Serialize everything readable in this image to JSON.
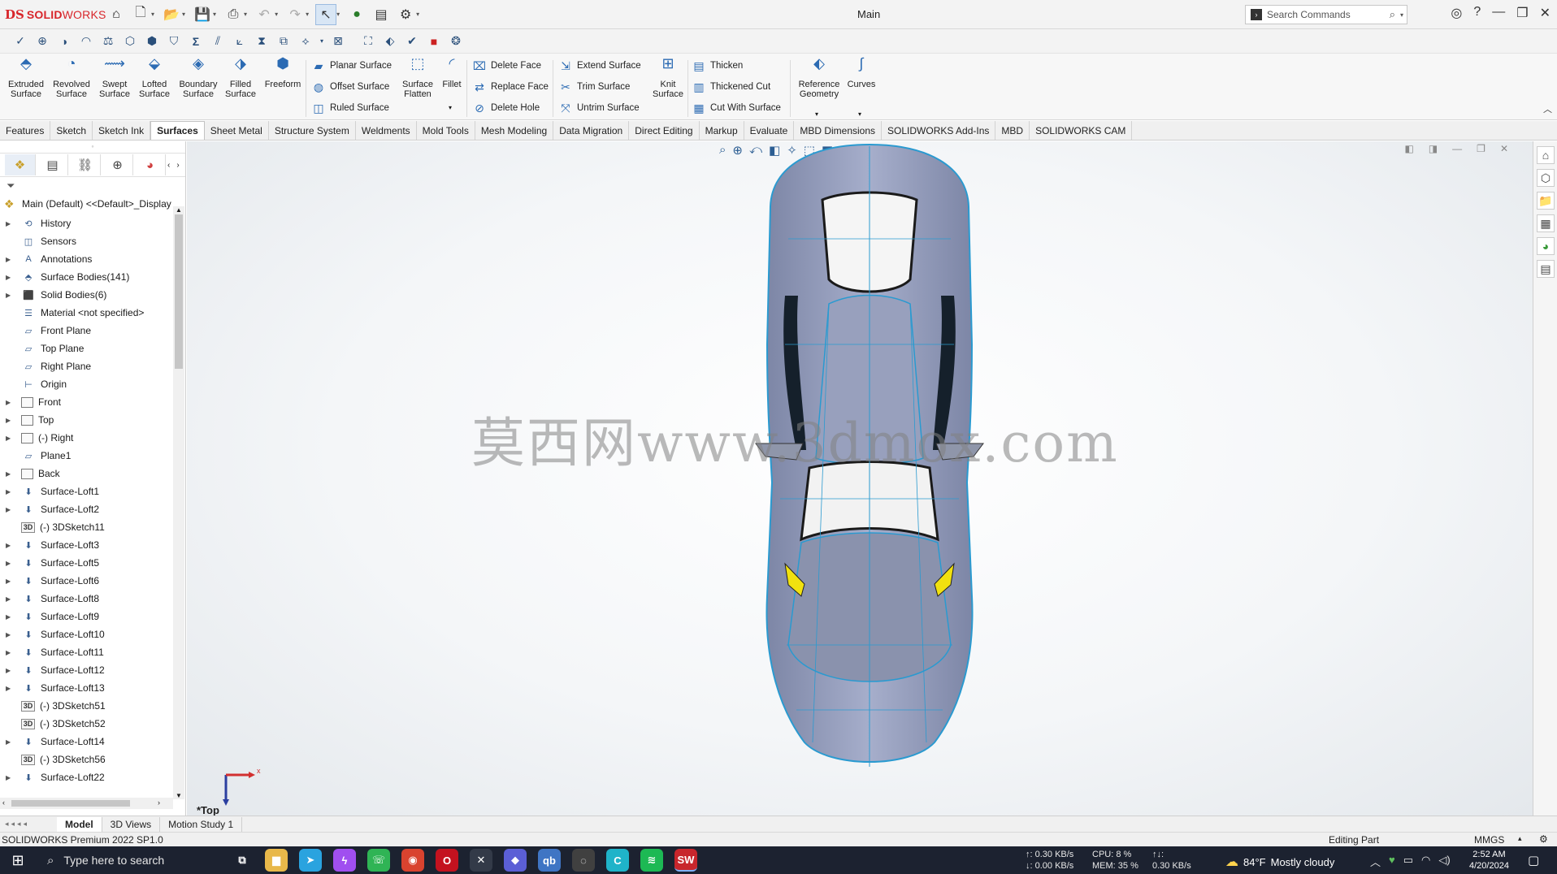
{
  "app": {
    "logo_ds": "DS",
    "logo_text_bold": "SOLID",
    "logo_text_rest": "WORKS",
    "doc_title": "Main",
    "search_placeholder": "Search Commands"
  },
  "ribbon": {
    "big_buttons": [
      {
        "label": "Extruded Surface",
        "icon": "extruded-surface-icon",
        "glyph": "⬘"
      },
      {
        "label": "Revolved Surface",
        "icon": "revolved-surface-icon",
        "glyph": "◔"
      },
      {
        "label": "Swept Surface",
        "icon": "swept-surface-icon",
        "glyph": "⟿"
      },
      {
        "label": "Lofted Surface",
        "icon": "lofted-surface-icon",
        "glyph": "⬙"
      },
      {
        "label": "Boundary Surface",
        "icon": "boundary-surface-icon",
        "glyph": "◈"
      },
      {
        "label": "Filled Surface",
        "icon": "filled-surface-icon",
        "glyph": "⬗"
      },
      {
        "label": "Freeform",
        "icon": "freeform-icon",
        "glyph": "⬢"
      }
    ],
    "group1": [
      {
        "label": "Planar Surface",
        "icon": "planar-surface-icon"
      },
      {
        "label": "Offset Surface",
        "icon": "offset-surface-icon"
      },
      {
        "label": "Ruled Surface",
        "icon": "ruled-surface-icon"
      }
    ],
    "mid_buttons": [
      {
        "label": "Surface Flatten",
        "icon": "surface-flatten-icon"
      },
      {
        "label": "Fillet",
        "icon": "fillet-icon"
      }
    ],
    "group2": [
      {
        "label": "Delete Face",
        "icon": "delete-face-icon"
      },
      {
        "label": "Replace Face",
        "icon": "replace-face-icon"
      },
      {
        "label": "Delete Hole",
        "icon": "delete-hole-icon"
      }
    ],
    "group3": [
      {
        "label": "Extend Surface",
        "icon": "extend-surface-icon"
      },
      {
        "label": "Trim Surface",
        "icon": "trim-surface-icon"
      },
      {
        "label": "Untrim Surface",
        "icon": "untrim-surface-icon"
      }
    ],
    "knit": {
      "label": "Knit Surface",
      "icon": "knit-surface-icon"
    },
    "group4": [
      {
        "label": "Thicken",
        "icon": "thicken-icon"
      },
      {
        "label": "Thickened Cut",
        "icon": "thickened-cut-icon"
      },
      {
        "label": "Cut With Surface",
        "icon": "cut-with-surface-icon"
      }
    ],
    "ref_geometry": {
      "label": "Reference Geometry",
      "icon": "reference-geometry-icon"
    },
    "curves": {
      "label": "Curves",
      "icon": "curves-icon"
    }
  },
  "tabs": [
    {
      "label": "Features"
    },
    {
      "label": "Sketch"
    },
    {
      "label": "Sketch Ink"
    },
    {
      "label": "Surfaces",
      "active": true
    },
    {
      "label": "Sheet Metal"
    },
    {
      "label": "Structure System"
    },
    {
      "label": "Weldments"
    },
    {
      "label": "Mold Tools"
    },
    {
      "label": "Mesh Modeling"
    },
    {
      "label": "Data Migration"
    },
    {
      "label": "Direct Editing"
    },
    {
      "label": "Markup"
    },
    {
      "label": "Evaluate"
    },
    {
      "label": "MBD Dimensions"
    },
    {
      "label": "SOLIDWORKS Add-Ins"
    },
    {
      "label": "MBD"
    },
    {
      "label": "SOLIDWORKS CAM"
    }
  ],
  "tree": {
    "root": "Main (Default) <<Default>_Display",
    "items": [
      {
        "label": "History",
        "icon": "history-icon",
        "expand": true
      },
      {
        "label": "Sensors",
        "icon": "sensors-icon",
        "expand": false
      },
      {
        "label": "Annotations",
        "icon": "annotations-icon",
        "expand": true
      },
      {
        "label": "Surface Bodies(141)",
        "icon": "surface-bodies-icon",
        "expand": true
      },
      {
        "label": "Solid Bodies(6)",
        "icon": "solid-bodies-icon",
        "expand": true
      },
      {
        "label": "Material <not specified>",
        "icon": "material-icon",
        "expand": false
      },
      {
        "label": "Front Plane",
        "icon": "plane-icon",
        "expand": false
      },
      {
        "label": "Top Plane",
        "icon": "plane-icon",
        "expand": false
      },
      {
        "label": "Right Plane",
        "icon": "plane-icon",
        "expand": false
      },
      {
        "label": "Origin",
        "icon": "origin-icon",
        "expand": false
      },
      {
        "label": "Front",
        "icon": "sketch-icon",
        "expand": true
      },
      {
        "label": "Top",
        "icon": "sketch-icon",
        "expand": true
      },
      {
        "label": "(-) Right",
        "icon": "sketch-icon",
        "expand": true
      },
      {
        "label": "Plane1",
        "icon": "plane-icon",
        "expand": false
      },
      {
        "label": "Back",
        "icon": "sketch-icon",
        "expand": true
      },
      {
        "label": "Surface-Loft1",
        "icon": "loft-icon",
        "expand": true
      },
      {
        "label": "Surface-Loft2",
        "icon": "loft-icon",
        "expand": true
      },
      {
        "label": "(-) 3DSketch11",
        "icon": "3dsketch-icon",
        "expand": false
      },
      {
        "label": "Surface-Loft3",
        "icon": "loft-icon",
        "expand": true
      },
      {
        "label": "Surface-Loft5",
        "icon": "loft-icon",
        "expand": true
      },
      {
        "label": "Surface-Loft6",
        "icon": "loft-icon",
        "expand": true
      },
      {
        "label": "Surface-Loft8",
        "icon": "loft-icon",
        "expand": true
      },
      {
        "label": "Surface-Loft9",
        "icon": "loft-icon",
        "expand": true
      },
      {
        "label": "Surface-Loft10",
        "icon": "loft-icon",
        "expand": true
      },
      {
        "label": "Surface-Loft11",
        "icon": "loft-icon",
        "expand": true
      },
      {
        "label": "Surface-Loft12",
        "icon": "loft-icon",
        "expand": true
      },
      {
        "label": "Surface-Loft13",
        "icon": "loft-icon",
        "expand": true
      },
      {
        "label": "(-) 3DSketch51",
        "icon": "3dsketch-icon",
        "expand": false
      },
      {
        "label": "(-) 3DSketch52",
        "icon": "3dsketch-icon",
        "expand": false
      },
      {
        "label": "Surface-Loft14",
        "icon": "loft-icon",
        "expand": true
      },
      {
        "label": "(-) 3DSketch56",
        "icon": "3dsketch-icon",
        "expand": false
      },
      {
        "label": "Surface-Loft22",
        "icon": "loft-icon",
        "expand": true
      }
    ]
  },
  "viewport": {
    "view_label": "*Top",
    "watermark": "莫西网www.3dmox.com",
    "triad_x": "x"
  },
  "bottom_tabs": [
    {
      "label": "Model",
      "active": true
    },
    {
      "label": "3D Views"
    },
    {
      "label": "Motion Study 1"
    }
  ],
  "status": {
    "version": "SOLIDWORKS Premium 2022 SP1.0",
    "mode": "Editing Part",
    "units": "MMGS"
  },
  "taskbar": {
    "search_placeholder": "Type here to search",
    "net_up": "↑: 0.30 KB/s",
    "net_down": "↓: 0.00 KB/s",
    "cpu": "CPU: 8 %",
    "mem": "MEM: 35 %",
    "disk_label": "↑↓:",
    "disk": "0.30 KB/s",
    "temp": "84°F",
    "weather": "Mostly cloudy",
    "time": "2:52 AM",
    "date": "4/20/2024",
    "apps": [
      {
        "name": "task-view-icon",
        "glyph": "⧉",
        "bg": "transparent"
      },
      {
        "name": "file-explorer-icon",
        "glyph": "▆",
        "bg": "#e8b84a"
      },
      {
        "name": "telegram-icon",
        "glyph": "➤",
        "bg": "#2aa3df"
      },
      {
        "name": "messenger-icon",
        "glyph": "ϟ",
        "bg": "#a04ff0"
      },
      {
        "name": "whatsapp-icon",
        "glyph": "☏",
        "bg": "#2fb455"
      },
      {
        "name": "chrome-icon",
        "glyph": "◉",
        "bg": "#d9432f"
      },
      {
        "name": "opera-icon",
        "glyph": "O",
        "bg": "#c4121f"
      },
      {
        "name": "xbox-icon",
        "glyph": "✕",
        "bg": "#333a48"
      },
      {
        "name": "plex-icon",
        "glyph": "◆",
        "bg": "#5b5fd6"
      },
      {
        "name": "qbittorrent-icon",
        "glyph": "qb",
        "bg": "#3f75c4"
      },
      {
        "name": "obs-icon",
        "glyph": "◌",
        "bg": "#404040"
      },
      {
        "name": "canva-icon",
        "glyph": "C",
        "bg": "#1fb3c9"
      },
      {
        "name": "spotify-icon",
        "glyph": "≋",
        "bg": "#1db954"
      },
      {
        "name": "solidworks-app-icon",
        "glyph": "SW",
        "bg": "#c8262c",
        "active": true
      }
    ]
  }
}
